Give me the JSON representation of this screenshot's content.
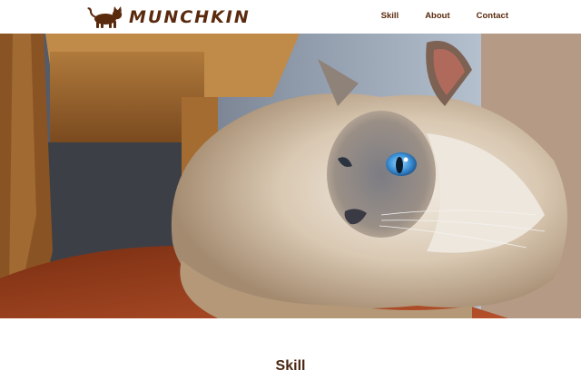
{
  "brand": {
    "name": "MUNCHKIN",
    "logo_icon": "cat-silhouette-icon",
    "color": "#5a2a0e"
  },
  "nav": {
    "items": [
      {
        "label": "Skill"
      },
      {
        "label": "About"
      },
      {
        "label": "Contact"
      }
    ]
  },
  "hero": {
    "image_alt": "photo of a fluffy blue-eyed Ragdoll cat lying on a wooden chair"
  },
  "sections": {
    "skill_title": "Skill"
  }
}
